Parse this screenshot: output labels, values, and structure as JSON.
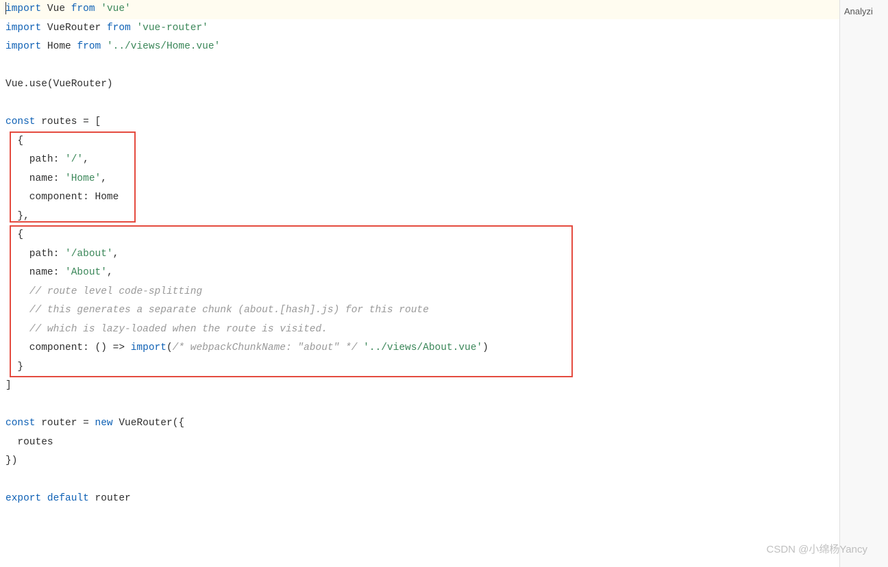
{
  "sidebar": {
    "analyzing": "Analyzi"
  },
  "watermark": "CSDN @小绵杨Yancy",
  "code": {
    "line1": {
      "kw1": "import",
      "id1": " Vue ",
      "kw2": "from",
      "sp": " ",
      "str1": "'vue'"
    },
    "line2": {
      "kw1": "import",
      "id1": " VueRouter ",
      "kw2": "from",
      "sp": " ",
      "str1": "'vue-router'"
    },
    "line3": {
      "kw1": "import",
      "id1": " Home ",
      "kw2": "from",
      "sp": " ",
      "str1": "'../views/Home.vue'"
    },
    "line5": {
      "id1": "Vue.use(VueRouter)"
    },
    "line7": {
      "kw1": "const",
      "id1": " routes = ["
    },
    "line8": {
      "id1": "  {"
    },
    "line9": {
      "id1": "    path: ",
      "str1": "'/'",
      "id2": ","
    },
    "line10": {
      "id1": "    name: ",
      "str1": "'Home'",
      "id2": ","
    },
    "line11": {
      "id1": "    component: Home"
    },
    "line12": {
      "id1": "  },"
    },
    "line13": {
      "id1": "  {"
    },
    "line14": {
      "id1": "    path: ",
      "str1": "'/about'",
      "id2": ","
    },
    "line15": {
      "id1": "    name: ",
      "str1": "'About'",
      "id2": ","
    },
    "line16": {
      "id1": "    ",
      "c1": "// route level code-splitting"
    },
    "line17": {
      "id1": "    ",
      "c1": "// this generates a separate chunk (about.[hash].js) for this route"
    },
    "line18": {
      "id1": "    ",
      "c1": "// which is lazy-loaded when the route is visited."
    },
    "line19": {
      "id1": "    component: () => ",
      "kw1": "import",
      "id2": "(",
      "c1": "/* webpackChunkName: \"about\" */",
      "sp": " ",
      "str1": "'../views/About.vue'",
      "id3": ")"
    },
    "line20": {
      "id1": "  }"
    },
    "line21": {
      "id1": "]"
    },
    "line23": {
      "kw1": "const",
      "id1": " router = ",
      "kw2": "new",
      "id2": " VueRouter({"
    },
    "line24": {
      "id1": "  routes"
    },
    "line25": {
      "id1": "})"
    },
    "line27": {
      "kw1": "export",
      "sp": " ",
      "kw2": "default",
      "id1": " router"
    }
  }
}
